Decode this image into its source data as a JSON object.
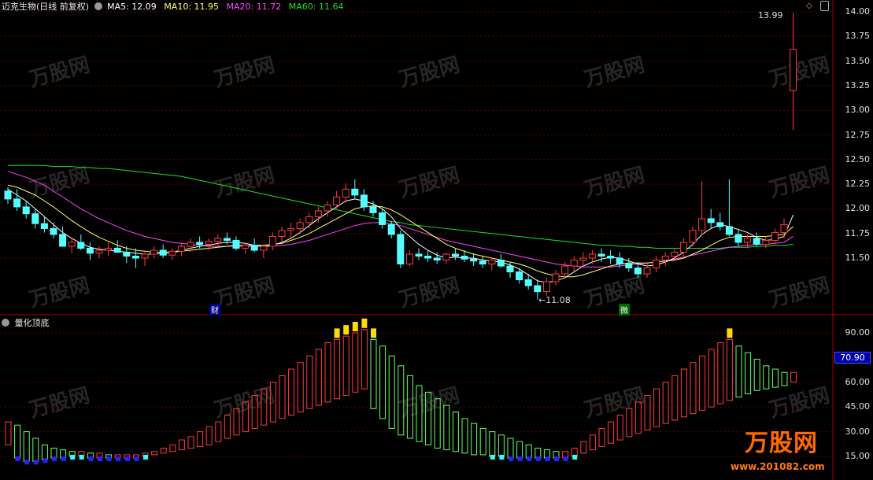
{
  "header": {
    "title": "迈克生物(日线 前复权)",
    "ma5": "MA5: 12.09",
    "ma10": "MA10: 11.95",
    "ma20": "MA20: 11.72",
    "ma60": "MA60: 11.64"
  },
  "indicator": {
    "title": "量化顶底",
    "current_value": "70.90",
    "axis_ticks": [
      "90.00",
      "60.00",
      "45.00",
      "30.00",
      "15.00"
    ]
  },
  "price_axis": {
    "ticks": [
      "14.00",
      "13.75",
      "13.50",
      "13.25",
      "13.00",
      "12.75",
      "12.50",
      "12.25",
      "12.00",
      "11.75",
      "11.50"
    ]
  },
  "annotations": {
    "high": "13.99",
    "low": "11.08",
    "tag_cai": "财",
    "tag_wei": "微"
  },
  "watermark": {
    "brand": "万股网",
    "site": "www.201082.com"
  },
  "colors": {
    "up": "#ff3b3b",
    "down": "#54ffff",
    "ma5": "#ffffff",
    "ma10": "#ffff66",
    "ma20": "#ff44ff",
    "ma60": "#22dd22",
    "grid": "#5a0000",
    "divider": "#aa0000"
  },
  "chart_data": {
    "type": "candlestick",
    "ylim": [
      11.0,
      14.05
    ],
    "candles": [
      [
        12.18,
        12.22,
        12.05,
        12.1
      ],
      [
        12.1,
        12.2,
        11.98,
        12.02
      ],
      [
        12.02,
        12.08,
        11.9,
        11.95
      ],
      [
        11.95,
        12.0,
        11.8,
        11.85
      ],
      [
        11.85,
        11.92,
        11.76,
        11.8
      ],
      [
        11.8,
        11.86,
        11.7,
        11.74
      ],
      [
        11.74,
        11.82,
        11.68,
        11.62
      ],
      [
        11.62,
        11.7,
        11.55,
        11.66
      ],
      [
        11.66,
        11.74,
        11.58,
        11.6
      ],
      [
        11.6,
        11.66,
        11.48,
        11.55
      ],
      [
        11.55,
        11.62,
        11.5,
        11.58
      ],
      [
        11.58,
        11.66,
        11.52,
        11.6
      ],
      [
        11.6,
        11.68,
        11.55,
        11.56
      ],
      [
        11.56,
        11.62,
        11.45,
        11.52
      ],
      [
        11.52,
        11.6,
        11.4,
        11.5
      ],
      [
        11.5,
        11.56,
        11.42,
        11.54
      ],
      [
        11.54,
        11.62,
        11.5,
        11.58
      ],
      [
        11.58,
        11.64,
        11.5,
        11.53
      ],
      [
        11.53,
        11.6,
        11.48,
        11.57
      ],
      [
        11.57,
        11.66,
        11.52,
        11.62
      ],
      [
        11.62,
        11.7,
        11.56,
        11.66
      ],
      [
        11.66,
        11.72,
        11.6,
        11.64
      ],
      [
        11.64,
        11.7,
        11.58,
        11.67
      ],
      [
        11.67,
        11.74,
        11.62,
        11.7
      ],
      [
        11.7,
        11.76,
        11.64,
        11.68
      ],
      [
        11.68,
        11.72,
        11.58,
        11.6
      ],
      [
        11.6,
        11.66,
        11.54,
        11.63
      ],
      [
        11.63,
        11.7,
        11.56,
        11.58
      ],
      [
        11.58,
        11.64,
        11.5,
        11.62
      ],
      [
        11.62,
        11.76,
        11.58,
        11.72
      ],
      [
        11.72,
        11.82,
        11.66,
        11.78
      ],
      [
        11.78,
        11.86,
        11.7,
        11.8
      ],
      [
        11.8,
        11.9,
        11.74,
        11.86
      ],
      [
        11.86,
        11.96,
        11.8,
        11.92
      ],
      [
        11.92,
        12.02,
        11.86,
        11.98
      ],
      [
        11.98,
        12.08,
        11.92,
        12.04
      ],
      [
        12.04,
        12.18,
        12.0,
        12.12
      ],
      [
        12.12,
        12.26,
        12.06,
        12.2
      ],
      [
        12.2,
        12.3,
        12.1,
        12.14
      ],
      [
        12.14,
        12.2,
        11.98,
        12.02
      ],
      [
        12.02,
        12.08,
        11.92,
        11.96
      ],
      [
        11.96,
        12.0,
        11.8,
        11.84
      ],
      [
        11.84,
        11.88,
        11.7,
        11.74
      ],
      [
        11.74,
        11.78,
        11.4,
        11.44
      ],
      [
        11.44,
        11.58,
        11.42,
        11.54
      ],
      [
        11.54,
        11.6,
        11.48,
        11.52
      ],
      [
        11.52,
        11.58,
        11.46,
        11.5
      ],
      [
        11.5,
        11.56,
        11.44,
        11.48
      ],
      [
        11.48,
        11.56,
        11.44,
        11.54
      ],
      [
        11.54,
        11.6,
        11.48,
        11.52
      ],
      [
        11.52,
        11.58,
        11.46,
        11.49
      ],
      [
        11.49,
        11.55,
        11.42,
        11.47
      ],
      [
        11.47,
        11.52,
        11.4,
        11.44
      ],
      [
        11.44,
        11.5,
        11.38,
        11.48
      ],
      [
        11.48,
        11.54,
        11.4,
        11.42
      ],
      [
        11.42,
        11.46,
        11.3,
        11.36
      ],
      [
        11.36,
        11.4,
        11.24,
        11.28
      ],
      [
        11.28,
        11.34,
        11.18,
        11.22
      ],
      [
        11.22,
        11.28,
        11.08,
        11.16
      ],
      [
        11.16,
        11.3,
        11.12,
        11.26
      ],
      [
        11.26,
        11.38,
        11.22,
        11.34
      ],
      [
        11.34,
        11.46,
        11.3,
        11.42
      ],
      [
        11.42,
        11.52,
        11.36,
        11.48
      ],
      [
        11.48,
        11.56,
        11.42,
        11.5
      ],
      [
        11.5,
        11.58,
        11.44,
        11.54
      ],
      [
        11.54,
        11.6,
        11.46,
        11.52
      ],
      [
        11.52,
        11.58,
        11.44,
        11.5
      ],
      [
        11.5,
        11.56,
        11.4,
        11.44
      ],
      [
        11.44,
        11.5,
        11.36,
        11.4
      ],
      [
        11.4,
        11.46,
        11.3,
        11.34
      ],
      [
        11.34,
        11.44,
        11.3,
        11.4
      ],
      [
        11.4,
        11.52,
        11.36,
        11.48
      ],
      [
        11.48,
        11.56,
        11.42,
        11.52
      ],
      [
        11.52,
        11.6,
        11.48,
        11.56
      ],
      [
        11.56,
        11.7,
        11.52,
        11.66
      ],
      [
        11.66,
        11.82,
        11.62,
        11.78
      ],
      [
        11.78,
        12.28,
        11.74,
        11.9
      ],
      [
        11.9,
        12.0,
        11.8,
        11.86
      ],
      [
        11.86,
        11.96,
        11.78,
        11.82
      ],
      [
        11.82,
        12.3,
        11.72,
        11.74
      ],
      [
        11.74,
        11.8,
        11.62,
        11.66
      ],
      [
        11.66,
        11.74,
        11.6,
        11.7
      ],
      [
        11.7,
        11.76,
        11.62,
        11.64
      ],
      [
        11.64,
        11.72,
        11.6,
        11.68
      ],
      [
        11.68,
        11.8,
        11.64,
        11.76
      ],
      [
        11.76,
        11.9,
        11.7,
        11.84
      ],
      [
        13.2,
        13.99,
        12.8,
        13.62
      ]
    ],
    "ma5": [
      12.2,
      12.14,
      12.08,
      12.0,
      11.92,
      11.84,
      11.76,
      11.7,
      11.65,
      11.61,
      11.59,
      11.58,
      11.57,
      11.56,
      11.55,
      11.54,
      11.54,
      11.55,
      11.56,
      11.58,
      11.6,
      11.62,
      11.63,
      11.65,
      11.66,
      11.66,
      11.65,
      11.63,
      11.62,
      11.63,
      11.66,
      11.7,
      11.76,
      11.83,
      11.9,
      11.96,
      12.02,
      12.08,
      12.1,
      12.08,
      12.05,
      12.0,
      11.92,
      11.8,
      11.72,
      11.64,
      11.58,
      11.53,
      11.5,
      11.51,
      11.5,
      11.5,
      11.48,
      11.47,
      11.46,
      11.43,
      11.39,
      11.33,
      11.27,
      11.25,
      11.27,
      11.3,
      11.36,
      11.42,
      11.46,
      11.49,
      11.51,
      11.5,
      11.47,
      11.44,
      11.42,
      11.43,
      11.46,
      11.5,
      11.56,
      11.64,
      11.74,
      11.8,
      11.84,
      11.82,
      11.79,
      11.76,
      11.71,
      11.68,
      11.69,
      11.72,
      11.94
    ],
    "ma10": [
      12.24,
      12.22,
      12.18,
      12.14,
      12.08,
      12.02,
      11.95,
      11.88,
      11.82,
      11.76,
      11.71,
      11.67,
      11.63,
      11.6,
      11.58,
      11.57,
      11.56,
      11.56,
      11.56,
      11.57,
      11.58,
      11.59,
      11.6,
      11.61,
      11.62,
      11.63,
      11.63,
      11.63,
      11.63,
      11.64,
      11.65,
      11.68,
      11.71,
      11.75,
      11.8,
      11.85,
      11.9,
      11.95,
      12.0,
      12.02,
      12.03,
      12.02,
      11.99,
      11.94,
      11.88,
      11.82,
      11.76,
      11.7,
      11.64,
      11.6,
      11.57,
      11.54,
      11.52,
      11.5,
      11.48,
      11.46,
      11.44,
      11.41,
      11.37,
      11.34,
      11.32,
      11.31,
      11.31,
      11.33,
      11.36,
      11.39,
      11.42,
      11.44,
      11.45,
      11.45,
      11.45,
      11.46,
      11.47,
      11.48,
      11.5,
      11.54,
      11.58,
      11.63,
      11.68,
      11.71,
      11.72,
      11.72,
      11.72,
      11.72,
      11.73,
      11.74,
      11.82
    ],
    "ma20": [
      12.38,
      12.35,
      12.32,
      12.28,
      12.24,
      12.18,
      12.12,
      12.06,
      12.0,
      11.95,
      11.9,
      11.86,
      11.82,
      11.78,
      11.75,
      11.72,
      11.7,
      11.68,
      11.66,
      11.65,
      11.64,
      11.63,
      11.62,
      11.62,
      11.62,
      11.62,
      11.62,
      11.62,
      11.62,
      11.62,
      11.63,
      11.64,
      11.66,
      11.68,
      11.71,
      11.74,
      11.77,
      11.8,
      11.83,
      11.85,
      11.86,
      11.86,
      11.85,
      11.83,
      11.8,
      11.77,
      11.74,
      11.71,
      11.68,
      11.66,
      11.64,
      11.62,
      11.6,
      11.58,
      11.56,
      11.54,
      11.52,
      11.5,
      11.48,
      11.46,
      11.44,
      11.43,
      11.42,
      11.41,
      11.41,
      11.41,
      11.41,
      11.42,
      11.43,
      11.44,
      11.45,
      11.46,
      11.47,
      11.49,
      11.51,
      11.53,
      11.55,
      11.57,
      11.59,
      11.61,
      11.62,
      11.63,
      11.64,
      11.64,
      11.65,
      11.66,
      11.72
    ],
    "ma60": [
      12.44,
      12.44,
      12.44,
      12.44,
      12.44,
      12.43,
      12.43,
      12.43,
      12.42,
      12.42,
      12.41,
      12.41,
      12.4,
      12.39,
      12.38,
      12.37,
      12.36,
      12.35,
      12.34,
      12.33,
      12.31,
      12.29,
      12.27,
      12.25,
      12.23,
      12.21,
      12.19,
      12.17,
      12.15,
      12.13,
      12.11,
      12.09,
      12.07,
      12.05,
      12.03,
      12.01,
      11.99,
      11.97,
      11.95,
      11.93,
      11.91,
      11.89,
      11.87,
      11.86,
      11.84,
      11.83,
      11.82,
      11.81,
      11.8,
      11.79,
      11.78,
      11.77,
      11.76,
      11.75,
      11.74,
      11.73,
      11.72,
      11.71,
      11.7,
      11.69,
      11.68,
      11.67,
      11.66,
      11.65,
      11.64,
      11.63,
      11.63,
      11.62,
      11.62,
      11.61,
      11.61,
      11.6,
      11.6,
      11.6,
      11.6,
      11.6,
      11.6,
      11.6,
      11.6,
      11.61,
      11.61,
      11.61,
      11.62,
      11.62,
      11.63,
      11.63,
      11.64
    ],
    "indicator": {
      "ylim": [
        10,
        100
      ],
      "bars": [
        [
          22,
          36
        ],
        [
          14,
          34
        ],
        [
          12,
          30
        ],
        [
          12,
          26
        ],
        [
          13,
          22
        ],
        [
          14,
          20
        ],
        [
          14,
          19
        ],
        [
          15,
          18
        ],
        [
          15,
          18
        ],
        [
          14,
          17
        ],
        [
          14,
          17
        ],
        [
          14,
          16
        ],
        [
          14,
          16
        ],
        [
          14,
          16
        ],
        [
          14,
          16
        ],
        [
          15,
          17
        ],
        [
          16,
          18
        ],
        [
          17,
          20
        ],
        [
          18,
          22
        ],
        [
          19,
          25
        ],
        [
          20,
          27
        ],
        [
          21,
          30
        ],
        [
          22,
          33
        ],
        [
          24,
          36
        ],
        [
          26,
          40
        ],
        [
          28,
          44
        ],
        [
          30,
          48
        ],
        [
          32,
          52
        ],
        [
          34,
          56
        ],
        [
          36,
          60
        ],
        [
          38,
          64
        ],
        [
          40,
          68
        ],
        [
          42,
          72
        ],
        [
          44,
          76
        ],
        [
          46,
          80
        ],
        [
          48,
          84
        ],
        [
          50,
          86
        ],
        [
          52,
          88
        ],
        [
          54,
          90
        ],
        [
          56,
          92
        ],
        [
          44,
          86
        ],
        [
          38,
          82
        ],
        [
          32,
          76
        ],
        [
          28,
          70
        ],
        [
          26,
          64
        ],
        [
          24,
          58
        ],
        [
          22,
          54
        ],
        [
          20,
          50
        ],
        [
          19,
          46
        ],
        [
          18,
          42
        ],
        [
          17,
          38
        ],
        [
          16,
          35
        ],
        [
          16,
          32
        ],
        [
          15,
          30
        ],
        [
          15,
          28
        ],
        [
          14,
          26
        ],
        [
          14,
          24
        ],
        [
          14,
          22
        ],
        [
          14,
          20
        ],
        [
          14,
          19
        ],
        [
          14,
          18
        ],
        [
          14,
          18
        ],
        [
          15,
          20
        ],
        [
          17,
          24
        ],
        [
          19,
          28
        ],
        [
          21,
          32
        ],
        [
          23,
          36
        ],
        [
          25,
          40
        ],
        [
          27,
          44
        ],
        [
          29,
          48
        ],
        [
          31,
          52
        ],
        [
          33,
          56
        ],
        [
          35,
          60
        ],
        [
          37,
          64
        ],
        [
          39,
          68
        ],
        [
          41,
          72
        ],
        [
          43,
          76
        ],
        [
          45,
          80
        ],
        [
          47,
          84
        ],
        [
          49,
          86
        ],
        [
          51,
          82
        ],
        [
          53,
          78
        ],
        [
          55,
          74
        ],
        [
          56,
          70
        ],
        [
          57,
          68
        ],
        [
          58,
          66
        ],
        [
          60,
          66
        ]
      ]
    }
  }
}
